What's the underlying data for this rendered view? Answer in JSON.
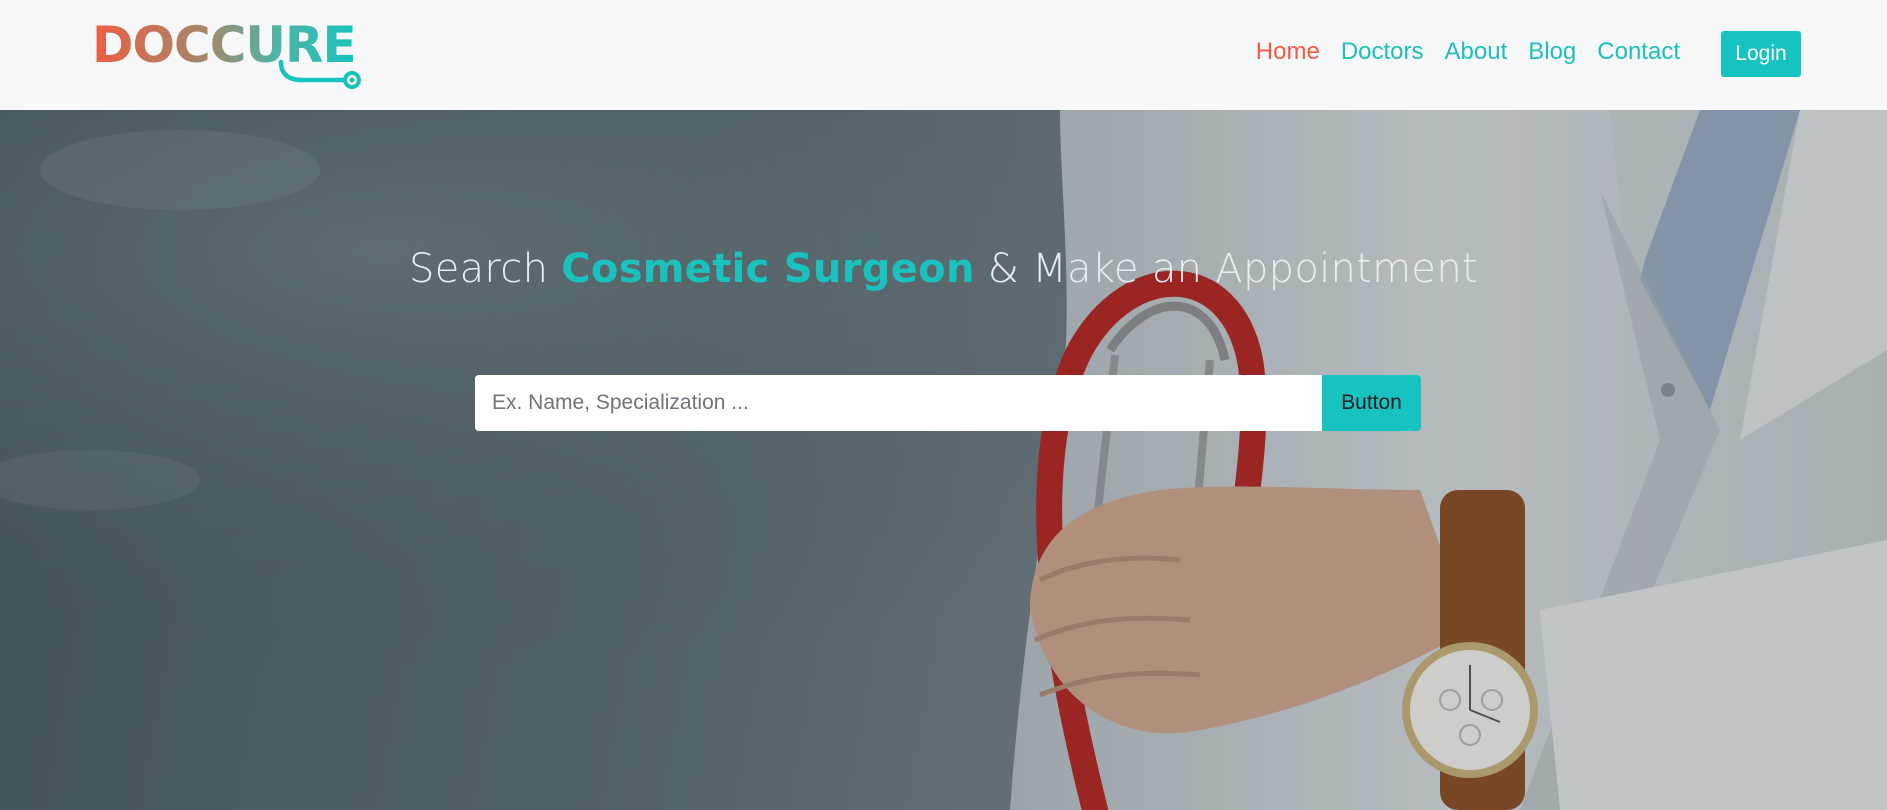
{
  "brand": {
    "logo_text": "DOCCURE",
    "colors": {
      "orange": "#ee5d42",
      "teal": "#19c2bd"
    }
  },
  "nav": {
    "items": [
      {
        "label": "Home",
        "active": true
      },
      {
        "label": "Doctors",
        "active": false
      },
      {
        "label": "About",
        "active": false
      },
      {
        "label": "Blog",
        "active": false
      },
      {
        "label": "Contact",
        "active": false
      }
    ],
    "login_label": "Login"
  },
  "hero": {
    "title_prefix": "Search ",
    "title_accent": "Cosmetic Surgeon",
    "title_suffix": " & Make an Appointment",
    "search": {
      "placeholder": "Ex. Name, Specialization ...",
      "value": "",
      "button_label": "Button"
    },
    "background_image": "doctor-with-stethoscope-photo"
  },
  "theme": {
    "accent": "#17c3be",
    "active_link": "#ee5d42",
    "header_bg": "#f7f8fa"
  }
}
